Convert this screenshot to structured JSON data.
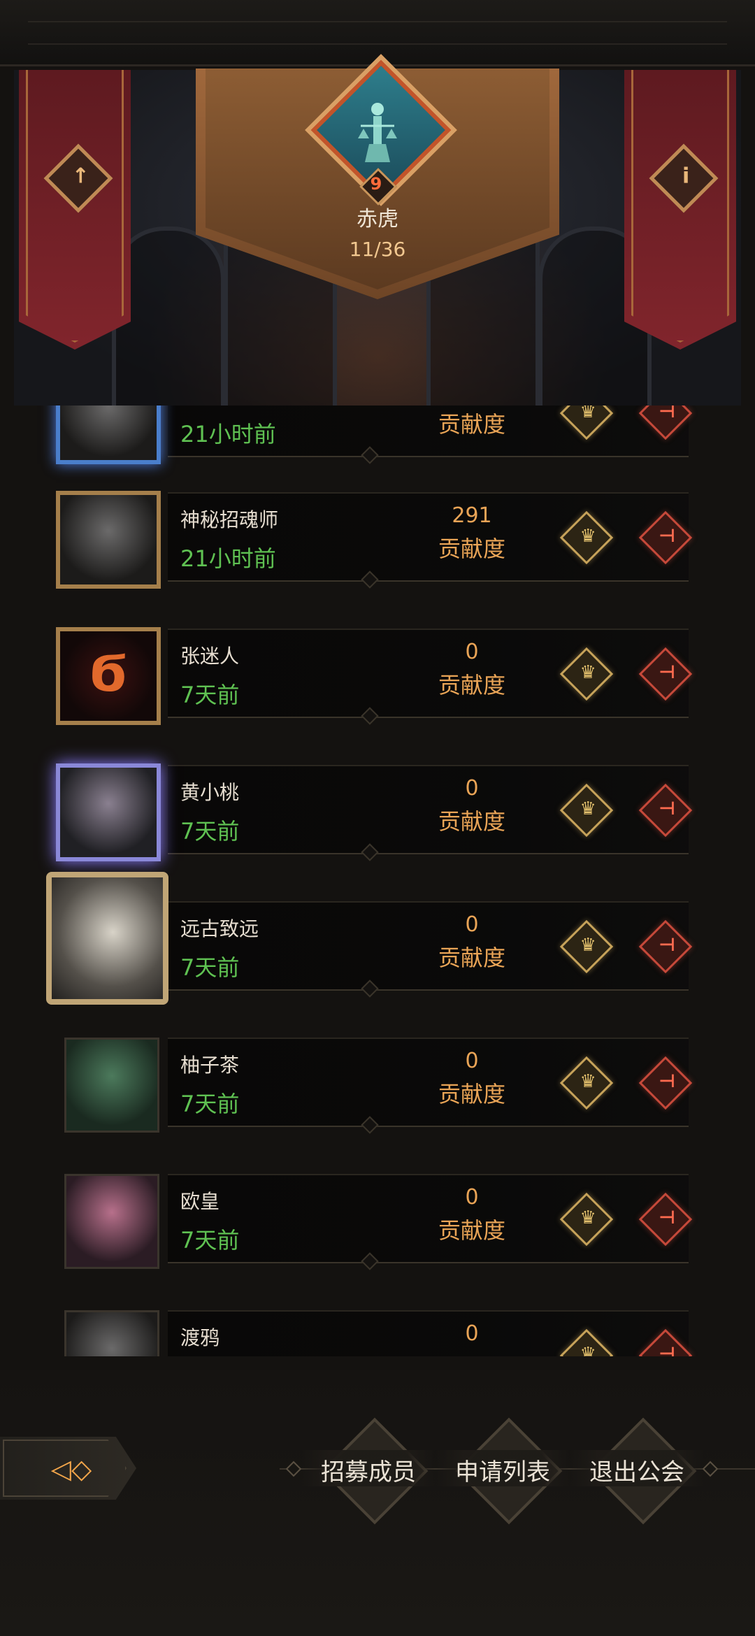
{
  "guild": {
    "level": "9",
    "name": "赤虎",
    "member_count": "11/36"
  },
  "members": [
    {
      "name": "",
      "time": "21小时前",
      "points": "",
      "points_label": "贡献度",
      "avatar": "blue"
    },
    {
      "name": "神秘招魂师",
      "time": "21小时前",
      "points": "291",
      "points_label": "贡献度",
      "avatar": "gold-frame"
    },
    {
      "name": "张迷人",
      "time": "7天前",
      "points": "0",
      "points_label": "贡献度",
      "avatar": "rune"
    },
    {
      "name": "黄小桃",
      "time": "7天前",
      "points": "0",
      "points_label": "贡献度",
      "avatar": "purple"
    },
    {
      "name": "远古致远",
      "time": "7天前",
      "points": "0",
      "points_label": "贡献度",
      "avatar": "eagle"
    },
    {
      "name": "柚子茶",
      "time": "7天前",
      "points": "0",
      "points_label": "贡献度",
      "avatar": "green"
    },
    {
      "name": "欧皇",
      "time": "7天前",
      "points": "0",
      "points_label": "贡献度",
      "avatar": "pink"
    },
    {
      "name": "渡鸦",
      "time": "",
      "points": "0",
      "points_label": "",
      "avatar": "plain"
    }
  ],
  "actions": {
    "recruit": "招募成员",
    "applications": "申请列表",
    "leave": "退出公会"
  },
  "icons": {
    "left_banner": "arrow-up-icon",
    "right_banner": "info-icon",
    "promote": "crown-promote-icon",
    "kick": "kick-door-icon",
    "back": "back-arrow-icon"
  },
  "colors": {
    "online_time": "#5fc152",
    "contribution": "#e9a456",
    "banner": "#81252c",
    "level_number": "#ff6b3a"
  }
}
